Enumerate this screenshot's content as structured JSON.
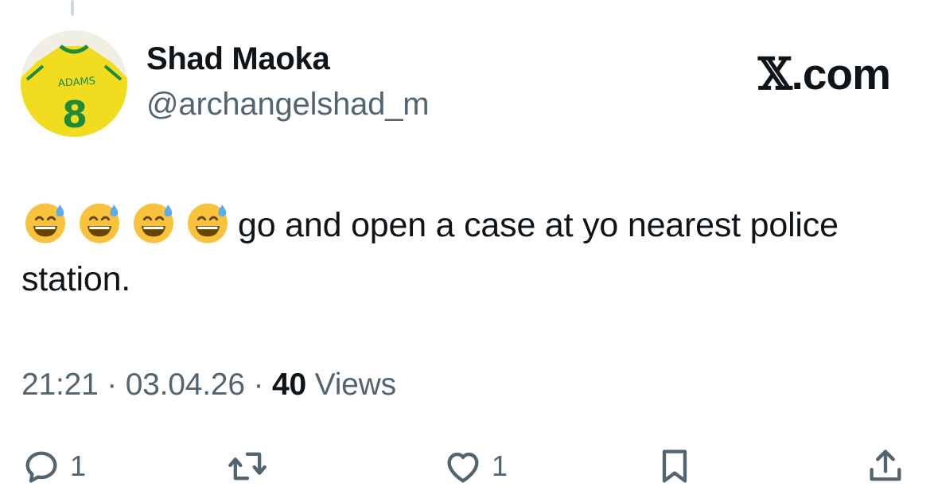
{
  "tweet": {
    "author": {
      "display_name": "Shad Maoka",
      "handle": "@archangelshad_m",
      "avatar_icon": "jersey-avatar",
      "avatar_text": "ADAMS 8"
    },
    "brand": {
      "x_letter": "𝕏",
      "suffix": ".com"
    },
    "text": "go and open a case at yo nearest police station.",
    "emoji_count": 4,
    "emoji_name": "grinning-face-with-sweat",
    "timestamp": {
      "time": "21:21",
      "separator": "·",
      "date": "03.04.26",
      "views_count": "40",
      "views_label": "Views"
    },
    "actions": {
      "reply": {
        "icon": "reply-icon",
        "count": "1"
      },
      "retweet": {
        "icon": "retweet-icon",
        "count": ""
      },
      "like": {
        "icon": "heart-icon",
        "count": "1"
      },
      "bookmark": {
        "icon": "bookmark-icon",
        "count": ""
      },
      "share": {
        "icon": "share-icon",
        "count": ""
      }
    }
  },
  "colors": {
    "text_primary": "#0f1419",
    "text_secondary": "#536471",
    "jersey_yellow": "#f2dc1f",
    "jersey_green": "#1e8a3a"
  }
}
